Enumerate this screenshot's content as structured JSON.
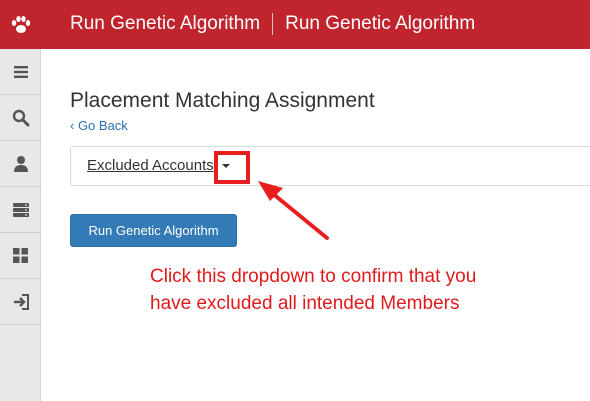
{
  "header": {
    "title_primary": "Run Genetic Algorithm",
    "title_secondary": "Run Genetic Algorithm",
    "bg_color": "#c0252e"
  },
  "sidebar": {
    "items": [
      {
        "icon": "menu-icon"
      },
      {
        "icon": "search-icon"
      },
      {
        "icon": "user-icon"
      },
      {
        "icon": "server-icon"
      },
      {
        "icon": "grid-icon"
      },
      {
        "icon": "sign-in-icon"
      }
    ]
  },
  "main": {
    "page_title": "Placement Matching Assignment",
    "back_link": "‹ Go Back",
    "dropdown_label": "Excluded Accounts",
    "run_button": "Run Genetic Algorithm"
  },
  "annotation": {
    "text_line1": "Click this dropdown to confirm that you",
    "text_line2": "have excluded all intended Members",
    "color": "#e01b1b"
  }
}
